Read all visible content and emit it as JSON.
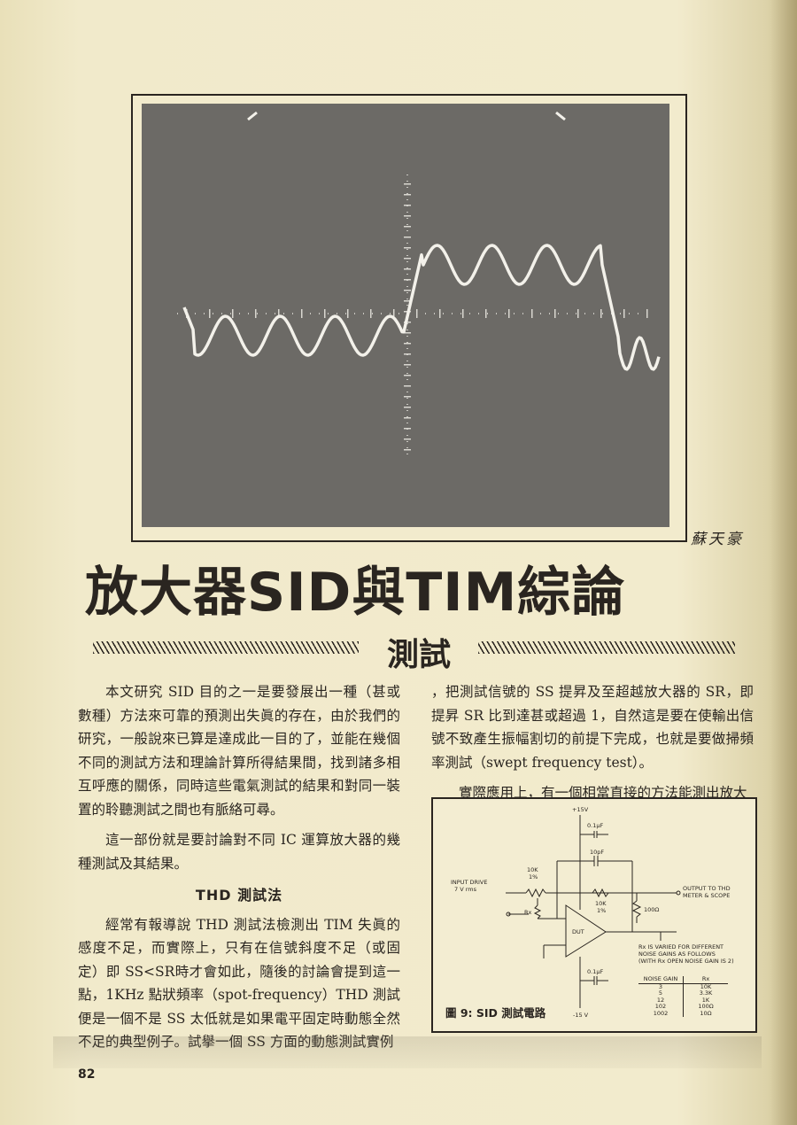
{
  "page": {
    "number": "82",
    "author": "蘇天豪",
    "title": "放大器SID與TIM綜論",
    "subtitle": "測試"
  },
  "left_column": {
    "p1": "本文研究 SID 目的之一是要發展出一種（甚或數種）方法來可靠的預測出失眞的存在，由於我們的研究，一般說來已算是達成此一目的了，並能在幾個不同的測試方法和理論計算所得結果間，找到諸多相互呼應的關係，同時這些電氣測試的結果和對同一裝置的聆聽測試之間也有脈絡可尋。",
    "p2": "這一部份就是要討論對不同 IC 運算放大器的幾種測試及其結果。",
    "section_head": "THD 測試法",
    "p3": "經常有報導說 THD 測試法檢測出 TIM 失眞的感度不足，而實際上，只有在信號斜度不足（或固定）即 SS<SR時才會如此，隨後的討論會提到這一點，1KHz 點狀頻率（spot-frequency）THD 測試便是一個不是 SS 太低就是如果電平固定時動態全然不足的典型例子。試擧一個 SS 方面的動態測試實例"
  },
  "right_column": {
    "p1": "，把測試信號的 SS 提昇及至超越放大器的 SR，即提昇 SR 比到達甚或超過 1，自然這是要在使輸出信號不致產生振幅割切的前提下完成，也就是要做掃頻率測試（swept frequency test）。",
    "p2": "實際應用上，有一個相當直接的方法能測出放大"
  },
  "figure": {
    "caption": "圖 9: SID 測試電路",
    "labels": {
      "vplus": "+15V",
      "vminus": "-15 V",
      "cap_top": "0.1μF",
      "cap_bottom": "0.1μF",
      "cap_fb": "10pF",
      "input_drive": "INPUT DRIVE",
      "input_level": "7 V rms",
      "r_in": "10K",
      "r_in_tol": "1%",
      "r_fb": "10K",
      "r_fb_tol": "1%",
      "r_load": "100Ω",
      "rx": "Rx",
      "dut": "DUT",
      "output1": "OUTPUT TO THD",
      "output2": "METER & SCOPE",
      "note1": "Rx IS VARIED FOR DIFFERENT",
      "note2": "NOISE GAINS AS FOLLOWS",
      "note3": "(WITH Rx OPEN NOISE GAIN IS 2)"
    },
    "table": {
      "headers": [
        "NOISE GAIN",
        "Rx"
      ],
      "rows": [
        [
          "3",
          "10K"
        ],
        [
          "5",
          "3.3K"
        ],
        [
          "12",
          "1K"
        ],
        [
          "102",
          "100Ω"
        ],
        [
          "1002",
          "10Ω"
        ]
      ]
    }
  },
  "oscillogram": {
    "description_colors": {
      "screen": "#6c6a66",
      "trace": "#f3f1ea",
      "grid": "#d9d7d0"
    }
  }
}
